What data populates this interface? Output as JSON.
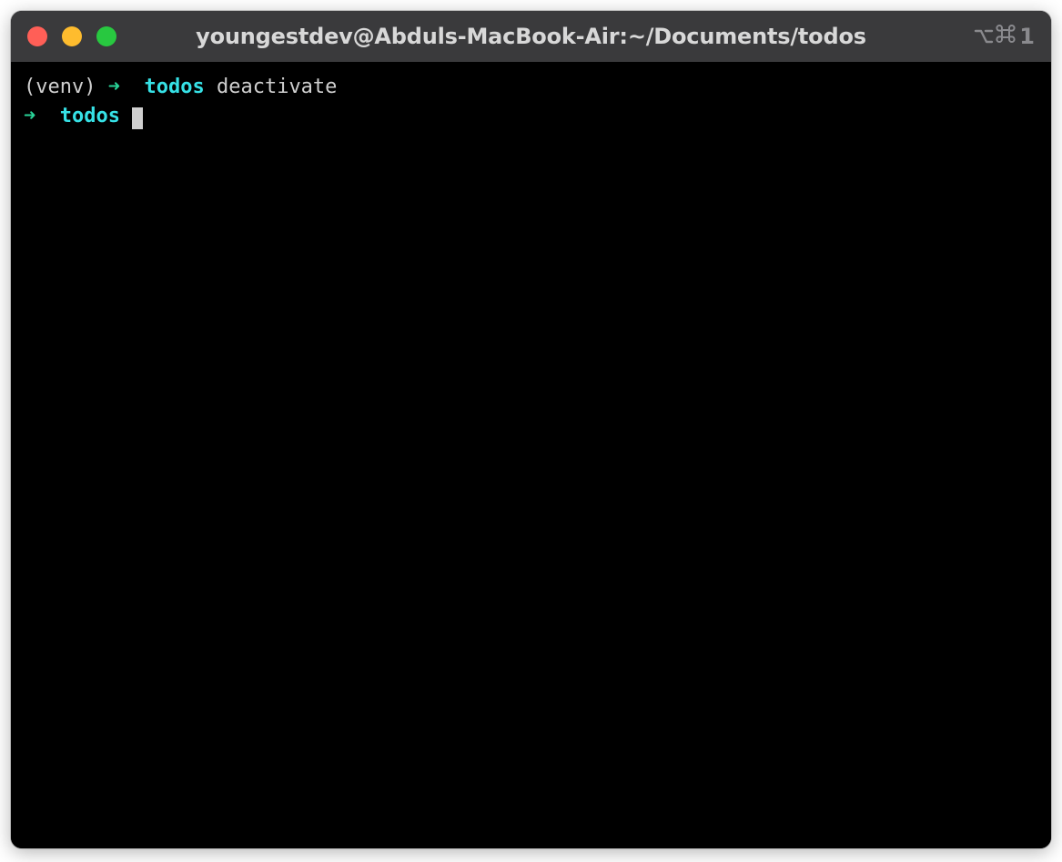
{
  "titlebar": {
    "title": "youngestdev@Abduls-MacBook-Air:~/Documents/todos",
    "pane_indicator": "1"
  },
  "terminal": {
    "lines": [
      {
        "venv": "(venv)",
        "arrow": "➜",
        "dir": "todos",
        "cmd": "deactivate"
      },
      {
        "arrow": "➜",
        "dir": "todos"
      }
    ]
  }
}
